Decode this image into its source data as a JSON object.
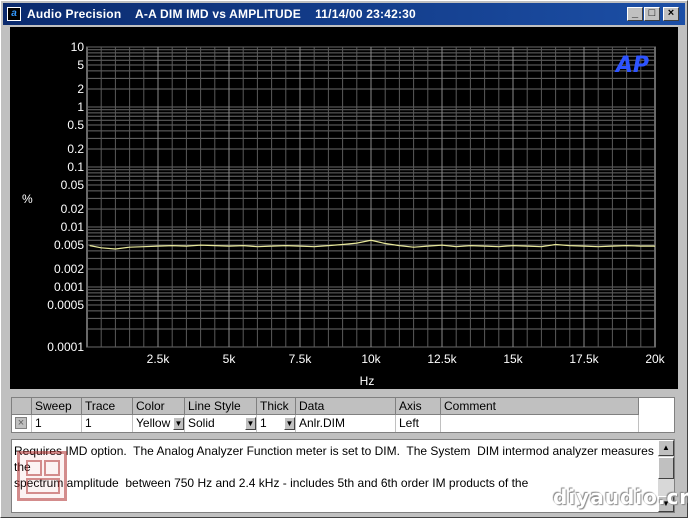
{
  "window": {
    "title": "Audio Precision    A-A DIM IMD vs AMPLITUDE    11/14/00 23:42:30",
    "app_icon": "ap-logo-icon",
    "controls": [
      "_",
      "□",
      "×"
    ]
  },
  "chart_data": {
    "type": "line",
    "xlabel": "Hz",
    "ylabel": "%",
    "xlim": [
      0,
      20000
    ],
    "x_ticks": [
      2500,
      5000,
      7500,
      10000,
      12500,
      15000,
      17500,
      20000
    ],
    "x_tick_labels": [
      "2.5k",
      "5k",
      "7.5k",
      "10k",
      "12.5k",
      "15k",
      "17.5k",
      "20k"
    ],
    "yscale": "log",
    "ylim": [
      0.0001,
      10
    ],
    "y_ticks": [
      10,
      5,
      2,
      1,
      0.5,
      0.2,
      0.1,
      0.05,
      0.02,
      0.01,
      0.005,
      0.002,
      0.001,
      0.0005,
      0.0001
    ],
    "y_tick_labels": [
      "10",
      "5",
      "2",
      "1",
      "0.5",
      "0.2",
      "0.1",
      "0.05",
      "0.02",
      "0.01",
      "0.005",
      "0.002",
      "0.001",
      "0.0005",
      "0.0001"
    ],
    "grid": true,
    "logo": "AP",
    "series": [
      {
        "color": "#e8e89a",
        "x": [
          100,
          500,
          1000,
          1500,
          2000,
          2500,
          3000,
          3500,
          4000,
          4500,
          5000,
          5500,
          6000,
          6500,
          7000,
          7500,
          8000,
          8500,
          9000,
          9500,
          10000,
          10500,
          11000,
          11500,
          12000,
          12500,
          13000,
          13500,
          14000,
          14500,
          15000,
          15500,
          16000,
          16500,
          17000,
          17500,
          18000,
          18500,
          19000,
          19500,
          20000
        ],
        "y": [
          0.0049,
          0.0045,
          0.0043,
          0.0046,
          0.0047,
          0.0048,
          0.0049,
          0.0048,
          0.005,
          0.0049,
          0.0048,
          0.0049,
          0.0047,
          0.0048,
          0.0049,
          0.0048,
          0.0047,
          0.0049,
          0.0051,
          0.0054,
          0.006,
          0.0053,
          0.0049,
          0.0046,
          0.0048,
          0.005,
          0.0047,
          0.0049,
          0.0048,
          0.0047,
          0.0049,
          0.0048,
          0.0047,
          0.0051,
          0.0049,
          0.0048,
          0.0047,
          0.0048,
          0.0049,
          0.0048,
          0.0048
        ]
      }
    ]
  },
  "sweep_table": {
    "headers": [
      "Sweep",
      "Trace",
      "Color",
      "Line Style",
      "Thick",
      "Data",
      "Axis",
      "Comment"
    ],
    "row": {
      "checkbox": "×",
      "sweep": "1",
      "trace": "1",
      "color": "Yellow",
      "line_style": "Solid",
      "thick": "1",
      "data": "Anlr.DIM",
      "axis": "Left",
      "comment": ""
    },
    "dropdown_glyph": "▼"
  },
  "notes": {
    "text": "Requires IMD option.  The Analog Analyzer Function meter is set to DIM.  The System  DIM intermod analyzer measures the\nspectrum amplitude  between 750 Hz and 2.4 kHz - includes 5th and 6th order IM products of the"
  },
  "watermark": "diyaudio.cn"
}
